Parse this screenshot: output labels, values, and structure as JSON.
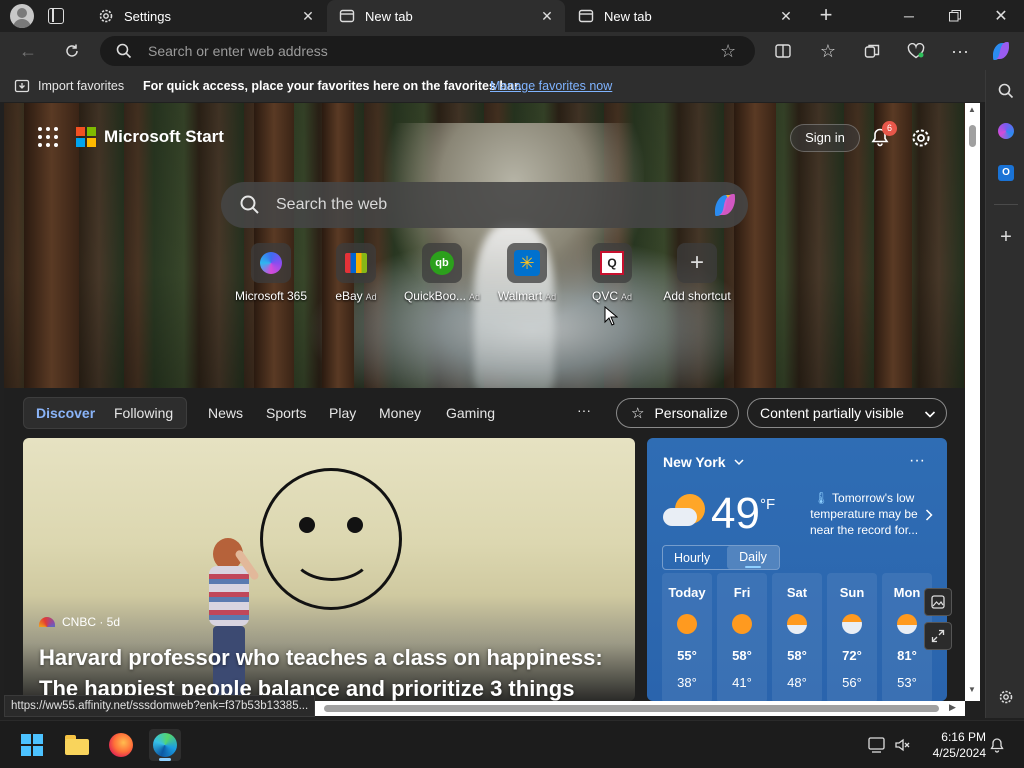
{
  "browser": {
    "tabs": [
      {
        "title": "Settings",
        "icon": "gear-icon"
      },
      {
        "title": "New tab",
        "icon": "newtab-icon"
      },
      {
        "title": "New tab",
        "icon": "newtab-icon"
      }
    ],
    "address_placeholder": "Search or enter web address",
    "favorites": {
      "import_label": "Import favorites",
      "hint": "For quick access, place your favorites here on the favorites bar.",
      "manage_link": "Manage favorites now"
    },
    "status_url": "https://ww55.affinity.net/sssdomweb?enk=f37b53b13385..."
  },
  "start": {
    "brand": "Microsoft Start",
    "sign_in": "Sign in",
    "notification_count": "6",
    "search_placeholder": "Search the web",
    "shortcuts": [
      {
        "label": "Microsoft 365",
        "ad": ""
      },
      {
        "label": "eBay",
        "ad": "Ad"
      },
      {
        "label": "QuickBoo...",
        "ad": "Ad"
      },
      {
        "label": "Walmart",
        "ad": "Ad"
      },
      {
        "label": "QVC",
        "ad": "Ad"
      },
      {
        "label": "Add shortcut",
        "ad": ""
      }
    ],
    "nav": {
      "discover": "Discover",
      "following": "Following",
      "items": [
        "News",
        "Sports",
        "Play",
        "Money",
        "Gaming"
      ],
      "more": "···",
      "personalize": "Personalize",
      "content_visibility": "Content partially visible"
    },
    "article": {
      "source": "CNBC · 5d",
      "headline": "Harvard professor who teaches a class on happiness: The happiest people balance and prioritize 3 things"
    },
    "weather": {
      "city": "New York",
      "temp": "49",
      "unit": "°F",
      "note": "Tomorrow's low temperature may be near the record for...",
      "tab_hourly": "Hourly",
      "tab_daily": "Daily",
      "days": [
        {
          "day": "Today",
          "hi": "55°",
          "lo": "38°"
        },
        {
          "day": "Fri",
          "hi": "58°",
          "lo": "41°"
        },
        {
          "day": "Sat",
          "hi": "58°",
          "lo": "48°"
        },
        {
          "day": "Sun",
          "hi": "72°",
          "lo": "56°"
        },
        {
          "day": "Mon",
          "hi": "81°",
          "lo": "53°"
        }
      ]
    }
  },
  "taskbar": {
    "time": "6:16 PM",
    "date": "4/25/2024"
  },
  "colors": {
    "accent_link": "#7fb3ff",
    "discover_blue": "#8ab4f8",
    "weather_bg": "#2f6db4",
    "notification_badge": "#e8574a"
  }
}
